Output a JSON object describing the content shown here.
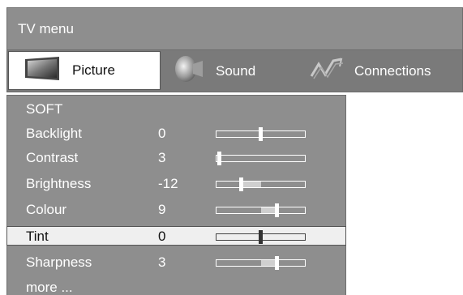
{
  "window": {
    "title": "TV menu"
  },
  "tabs": [
    {
      "label": "Picture",
      "icon": "tv-icon",
      "active": true
    },
    {
      "label": "Sound",
      "icon": "speaker-icon",
      "active": false
    },
    {
      "label": "Connections",
      "icon": "plug-icon",
      "active": false
    }
  ],
  "menu": {
    "preset": "SOFT",
    "settings": [
      {
        "label": "Backlight",
        "value": "0",
        "level": 0.5,
        "min": -50,
        "max": 50
      },
      {
        "label": "Contrast",
        "value": "3",
        "level": 0.03
      },
      {
        "label": "Brightness",
        "value": "-12",
        "level": 0.28,
        "fill_from": 0.28,
        "fill_to": 0.5
      },
      {
        "label": "Colour",
        "value": "9",
        "level": 0.68,
        "fill_from": 0.5,
        "fill_to": 0.68
      },
      {
        "label": "Tint",
        "value": "0",
        "level": 0.5,
        "selected": true
      },
      {
        "label": "Sharpness",
        "value": "3",
        "level": 0.68,
        "fill_from": 0.5,
        "fill_to": 0.68
      }
    ],
    "more_label": "more ..."
  },
  "colors": {
    "panel": "#8e8e8e",
    "tab_row": "#7a7a7a",
    "selected_row": "#efefef"
  }
}
